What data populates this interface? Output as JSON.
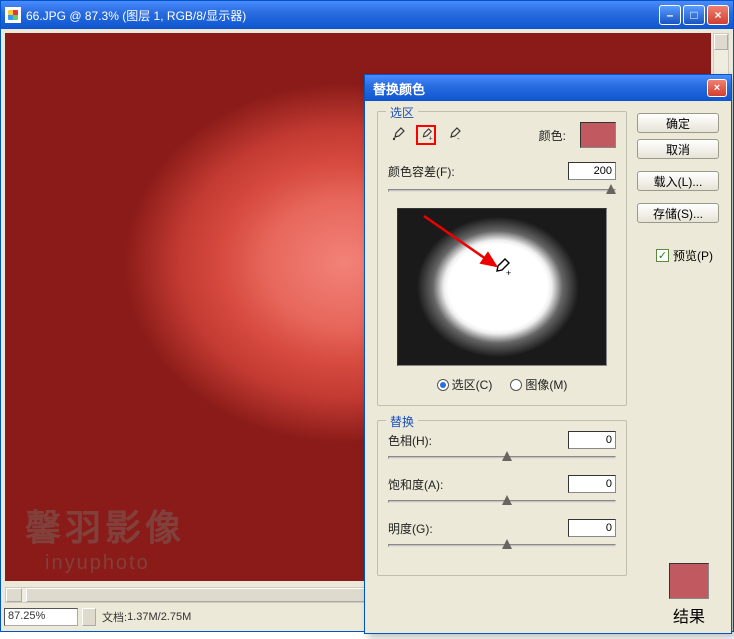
{
  "doc": {
    "title": "66.JPG @ 87.3% (图层 1, RGB/8/显示器)",
    "zoom_text": "87.25%",
    "doc_info_label": "文档:",
    "doc_info_value": "1.37M/2.75M",
    "watermark1": "馨羽影像",
    "watermark2": "inyuphoto"
  },
  "dialog": {
    "title": "替换颜色",
    "buttons": {
      "ok": "确定",
      "cancel": "取消",
      "load": "载入(L)...",
      "save": "存储(S)..."
    },
    "preview_checkbox": "预览(P)",
    "selection": {
      "group_label": "选区",
      "color_label": "颜色:",
      "color_swatch": "#c15a60",
      "fuzziness_label": "颜色容差(F):",
      "fuzziness_value": "200",
      "radio_selection": "选区(C)",
      "radio_image": "图像(M)"
    },
    "replace": {
      "group_label": "替换",
      "hue_label": "色相(H):",
      "hue_value": "0",
      "sat_label": "饱和度(A):",
      "sat_value": "0",
      "light_label": "明度(G):",
      "light_value": "0",
      "result_label": "结果",
      "result_swatch": "#c15a60"
    }
  }
}
